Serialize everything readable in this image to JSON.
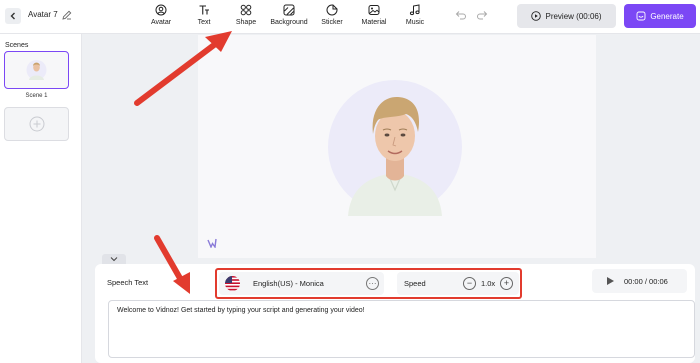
{
  "header": {
    "back_icon": "chevron-left-icon",
    "project_title": "Avatar 7",
    "edit_icon": "pencil-icon",
    "tools": [
      {
        "label": "Avatar",
        "icon": "avatar-icon"
      },
      {
        "label": "Text",
        "icon": "text-icon"
      },
      {
        "label": "Shape",
        "icon": "shape-icon"
      },
      {
        "label": "Background",
        "icon": "background-icon"
      },
      {
        "label": "Sticker",
        "icon": "sticker-icon"
      },
      {
        "label": "Material",
        "icon": "material-icon"
      },
      {
        "label": "Music",
        "icon": "music-icon"
      }
    ],
    "preview_label": "Preview (00:06)",
    "generate_label": "Generate"
  },
  "sidebar": {
    "title": "Scenes",
    "scenes": [
      {
        "label": "Scene 1"
      }
    ],
    "add_icon": "plus-icon"
  },
  "speech": {
    "label": "Speech Text",
    "voice_name": "English(US) - Monica",
    "voice_flag": "us-flag-icon",
    "speed_label": "Speed",
    "speed_value": "1.0x",
    "time": "00:00 / 00:06",
    "script": "Welcome to Vidnoz! Get started by typing your script and generating your video!"
  },
  "colors": {
    "accent": "#7b47f5",
    "annotation": "#e23b2e",
    "canvas_bg": "#eef0f3",
    "avatar_circle": "#ecebf9"
  }
}
